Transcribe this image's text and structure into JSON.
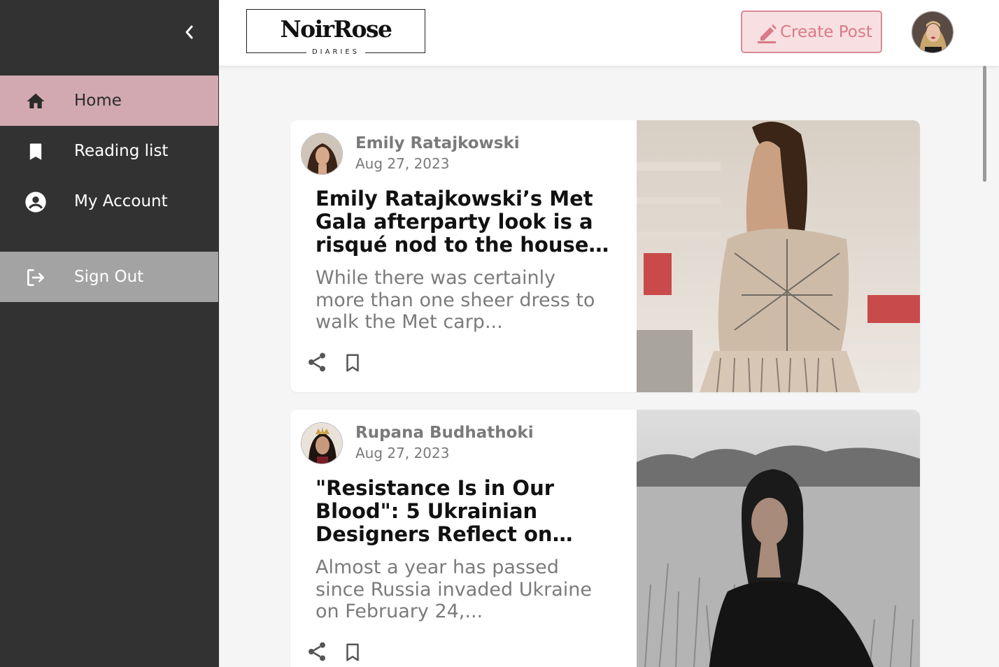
{
  "sidebar": {
    "items": [
      {
        "label": "Home",
        "icon": "home-icon",
        "active": true
      },
      {
        "label": "Reading list",
        "icon": "bookmark-icon"
      },
      {
        "label": "My Account",
        "icon": "account-circle-icon"
      },
      {
        "label": "Sign Out",
        "icon": "logout-icon"
      }
    ]
  },
  "header": {
    "logo_main": "NoirRose",
    "logo_sub": "DIARIES",
    "create_label": "Create Post"
  },
  "colors": {
    "sidebar_bg": "#323232",
    "active_nav": "#d3a9b1",
    "signout_bg": "#a3a3a3",
    "accent_pink": "#d87a87",
    "page_bg": "#f5f5f5"
  },
  "posts": [
    {
      "author": "Emily Ratajkowski",
      "date": "Aug 27, 2023",
      "title": "Emily Ratajkowski’s Met Gala afterparty look is a risqué nod to the house o...",
      "excerpt": "While there was certainly more than one sheer dress to walk the Met carp..."
    },
    {
      "author": "Rupana Budhathoki",
      "date": "Aug 27, 2023",
      "title": "\"Resistance Is in Our Blood\": 5 Ukrainian Designers Reflect on The...",
      "excerpt": "Almost a year has passed since Russia invaded Ukraine on February 24,..."
    }
  ]
}
